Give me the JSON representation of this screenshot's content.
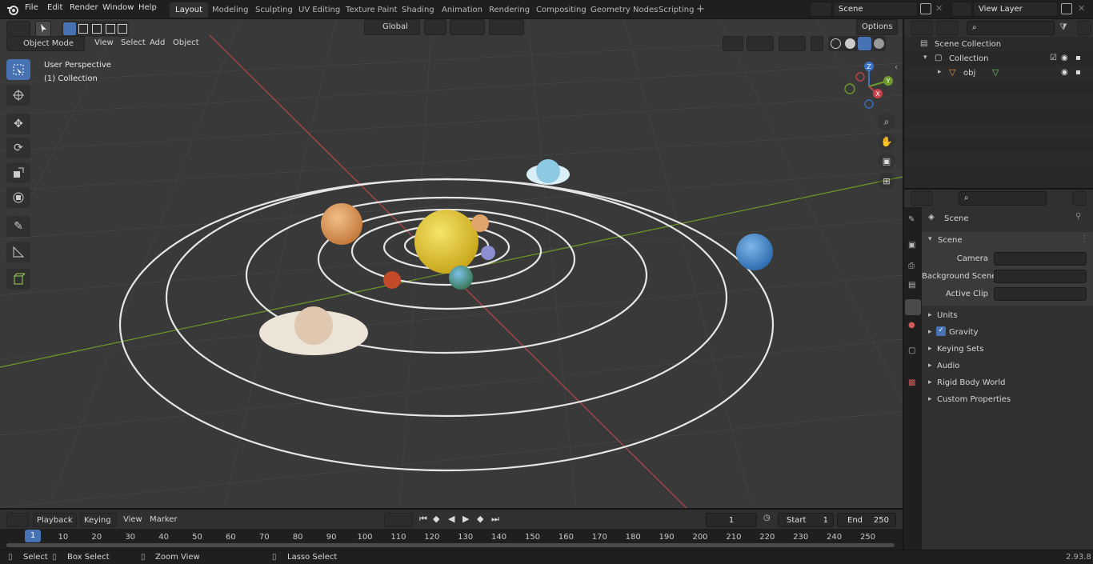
{
  "top_menu": {
    "items": [
      "File",
      "Edit",
      "Render",
      "Window",
      "Help"
    ]
  },
  "workspaces": [
    "Layout",
    "Modeling",
    "Sculpting",
    "UV Editing",
    "Texture Paint",
    "Shading",
    "Animation",
    "Rendering",
    "Compositing",
    "Geometry Nodes",
    "Scripting"
  ],
  "scene_field": "Scene",
  "view_layer_field": "View Layer",
  "viewport": {
    "mode": "Object Mode",
    "menus": [
      "View",
      "Select",
      "Add",
      "Object"
    ],
    "transform_orientation": "Global",
    "options_label": "Options",
    "overlay_title": "User Perspective",
    "overlay_subtitle": "(1) Collection",
    "gizmo": {
      "z": "Z",
      "y": "Y",
      "x": "X"
    }
  },
  "outliner": {
    "root": "Scene Collection",
    "collection": "Collection",
    "object": "obj"
  },
  "properties": {
    "header": "Scene",
    "panel": "Scene",
    "fields": [
      {
        "label": "Camera",
        "value": ""
      },
      {
        "label": "Background Scene",
        "value": ""
      },
      {
        "label": "Active Clip",
        "value": ""
      }
    ],
    "sections": [
      "Units",
      "Gravity",
      "Keying Sets",
      "Audio",
      "Rigid Body World",
      "Custom Properties"
    ]
  },
  "timeline": {
    "menus": [
      "Playback",
      "Keying",
      "View",
      "Marker"
    ],
    "current_frame": "1",
    "start_label": "Start",
    "start_value": "1",
    "end_label": "End",
    "end_value": "250",
    "ticks": [
      "10",
      "20",
      "30",
      "40",
      "50",
      "60",
      "70",
      "80",
      "90",
      "100",
      "110",
      "120",
      "130",
      "140",
      "150",
      "160",
      "170",
      "180",
      "190",
      "200",
      "210",
      "220",
      "230",
      "240",
      "250"
    ],
    "cursor_frame": "1"
  },
  "status": {
    "select": "Select",
    "box_select": "Box Select",
    "zoom_view": "Zoom View",
    "lasso_select": "Lasso Select",
    "version": "2.93.8"
  },
  "colors": {
    "accent": "#4772b3",
    "x_axis": "#b8454b",
    "y_axis": "#6e9a2a",
    "sun": "#e8c83a"
  }
}
